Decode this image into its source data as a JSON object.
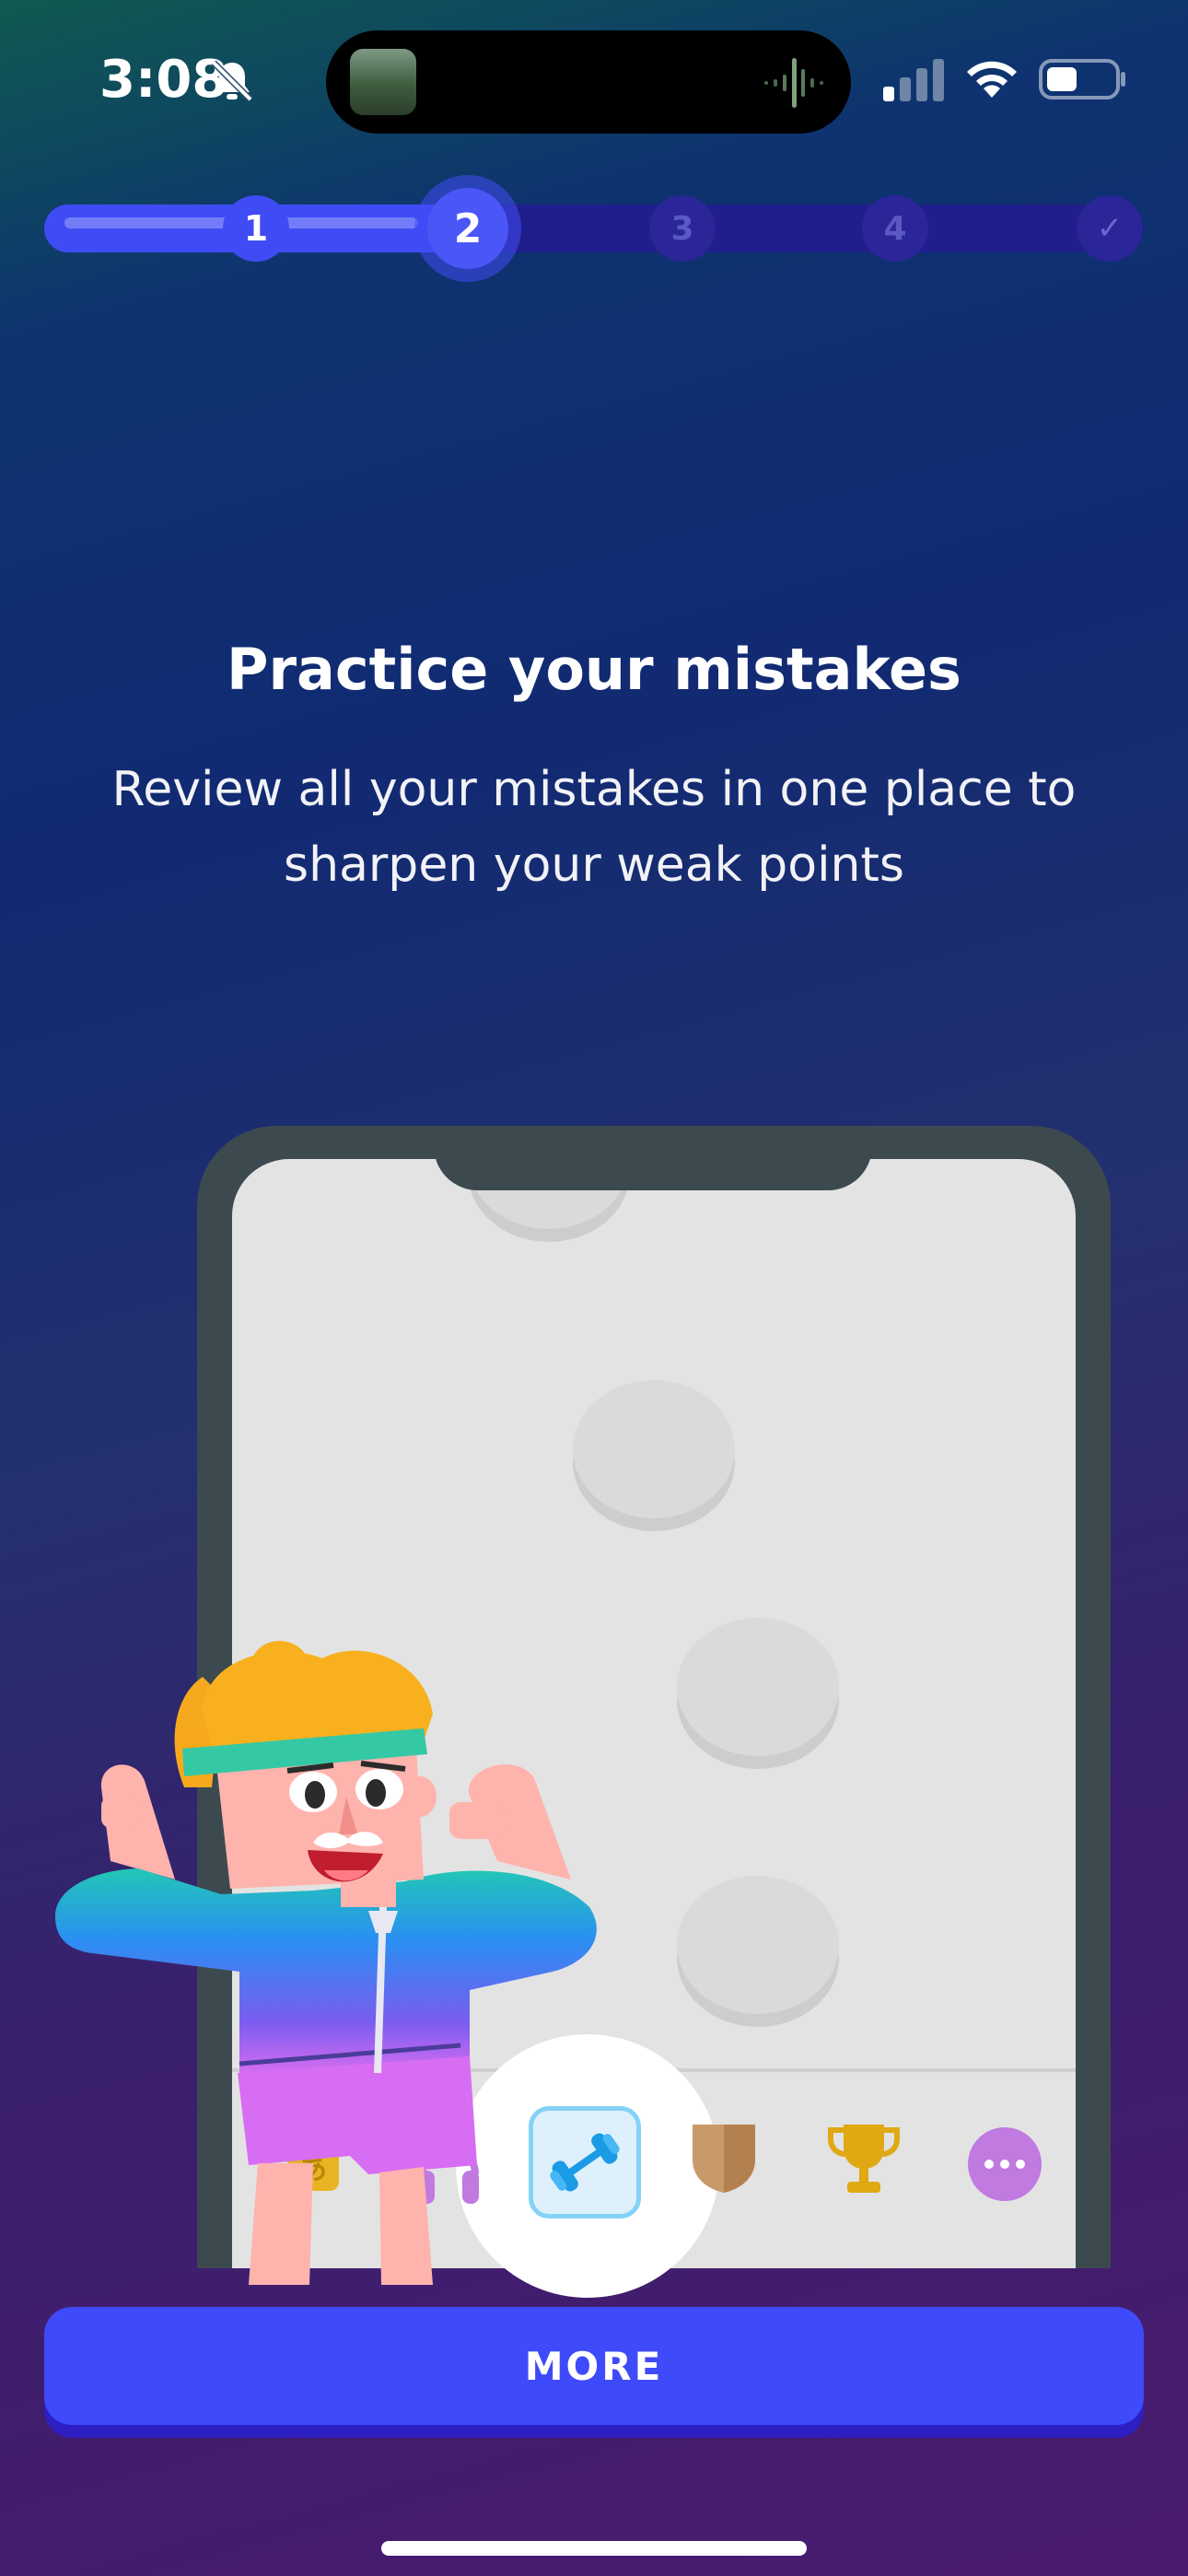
{
  "status_bar": {
    "time": "3:08",
    "icons": [
      "bell-slash-icon",
      "signal-icon",
      "wifi-icon",
      "battery-icon"
    ]
  },
  "progress": {
    "current_step": 2,
    "total_steps": 5,
    "fill_fraction": 0.38,
    "steps": [
      {
        "label": "1",
        "state": "done"
      },
      {
        "label": "2",
        "state": "current"
      },
      {
        "label": "3",
        "state": "todo"
      },
      {
        "label": "4",
        "state": "todo"
      },
      {
        "label": "✓",
        "state": "finish"
      }
    ]
  },
  "content": {
    "title": "Practice your mistakes",
    "subtitle": "Review all your mistakes in one place to sharpen your weak points"
  },
  "illustration": {
    "tab_icons": [
      "letters-icon",
      "headphones-icon",
      "dumbbell-icon",
      "shield-icon",
      "trophy-icon",
      "more-icon"
    ],
    "selected_tab": "dumbbell-icon"
  },
  "cta": {
    "label": "MORE"
  },
  "colors": {
    "accent": "#3f4bfa",
    "track": "#201d8c",
    "practice_tab_border": "#84d2f7"
  }
}
